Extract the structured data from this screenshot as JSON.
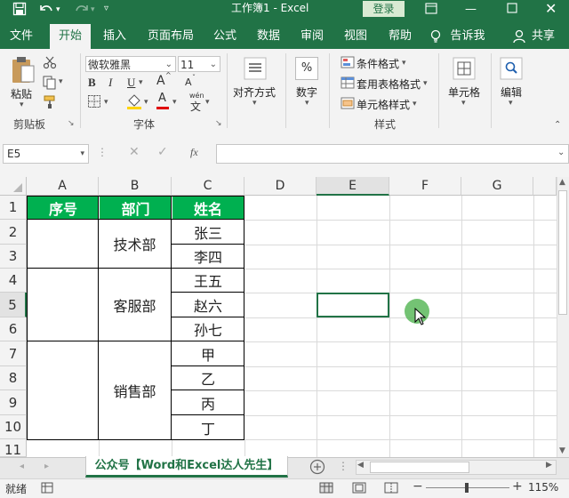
{
  "titlebar": {
    "title": "工作簿1  -  Excel",
    "login": "登录"
  },
  "tabs": [
    "文件",
    "开始",
    "插入",
    "页面布局",
    "公式",
    "数据",
    "审阅",
    "视图",
    "帮助",
    "告诉我",
    "共享"
  ],
  "ribbon": {
    "clipboard": {
      "paste": "粘贴",
      "group": "剪贴板"
    },
    "font": {
      "name": "微软雅黑",
      "size": "11",
      "group": "字体",
      "bold": "B",
      "italic": "I",
      "underline": "U",
      "grow": "A",
      "shrink": "A",
      "fontcolor": "A",
      "phonetic": "wén",
      "phonetic_char": "文"
    },
    "alignment": {
      "label": "对齐方式"
    },
    "number": {
      "label": "数字",
      "icon": "%"
    },
    "styles": {
      "conditional": "条件格式",
      "table": "套用表格格式",
      "cell": "单元格样式",
      "group": "样式"
    },
    "cells": {
      "label": "单元格"
    },
    "editing": {
      "label": "编辑"
    }
  },
  "formula_bar": {
    "name_box": "E5",
    "fx": "fx",
    "value": ""
  },
  "columns": [
    "A",
    "B",
    "C",
    "D",
    "E",
    "F",
    "G"
  ],
  "rows": [
    "1",
    "2",
    "3",
    "4",
    "5",
    "6",
    "7",
    "8",
    "9",
    "10",
    "11"
  ],
  "table": {
    "headers": [
      "序号",
      "部门",
      "姓名"
    ],
    "departments": [
      "技术部",
      "客服部",
      "销售部"
    ],
    "names": [
      "张三",
      "李四",
      "王五",
      "赵六",
      "孙七",
      "甲",
      "乙",
      "丙",
      "丁"
    ]
  },
  "sheet_tab": "公众号【Word和Excel达人先生】",
  "status": {
    "ready": "就绪",
    "zoom": "115%"
  },
  "colors": {
    "excel_green": "#217346",
    "header_fill": "#00b050"
  }
}
